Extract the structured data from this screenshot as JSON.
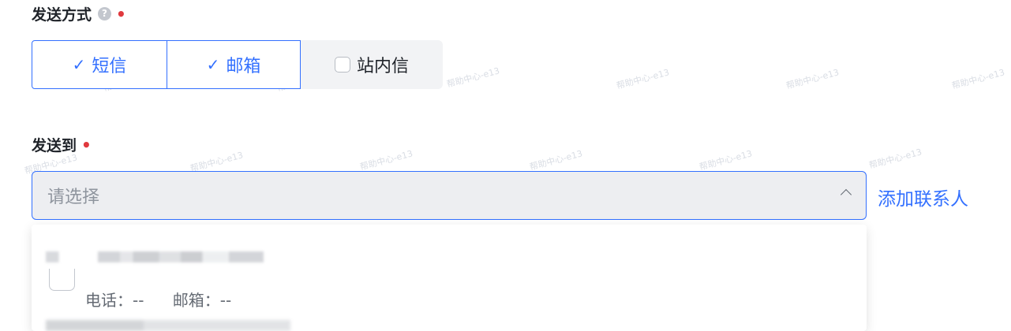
{
  "send_method": {
    "label": "发送方式",
    "help_icon": "question-circle-icon",
    "required_mark": "•",
    "options": [
      {
        "label": "短信",
        "checked": true
      },
      {
        "label": "邮箱",
        "checked": true
      },
      {
        "label": "站内信",
        "checked": false
      }
    ]
  },
  "send_to": {
    "label": "发送到",
    "required_mark": "•",
    "select_placeholder": "请选择",
    "add_contact_label": "添加联系人",
    "dropdown": {
      "option": {
        "phone_label": "电话：--",
        "email_label": "邮箱：--"
      }
    }
  },
  "watermark_text": "帮助中心-e13",
  "colors": {
    "accent": "#3370ff",
    "required": "#e0393e",
    "select_bg": "#edeef1"
  }
}
